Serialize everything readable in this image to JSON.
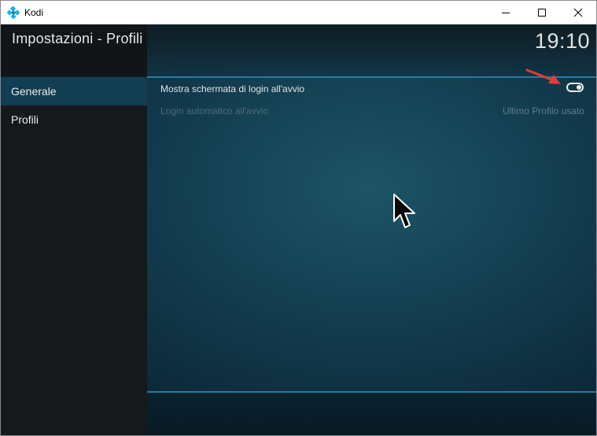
{
  "window": {
    "title": "Kodi",
    "icon": "kodi-logo-icon",
    "controls": [
      "minimize-icon",
      "maximize-icon",
      "close-icon"
    ]
  },
  "header": {
    "title": "Impostazioni - Profili",
    "clock": "19:10"
  },
  "sidebar": {
    "items": [
      {
        "label": "Generale",
        "active": true
      },
      {
        "label": "Profili",
        "active": false
      }
    ]
  },
  "settings": [
    {
      "label": "Mostra schermata di login all'avvio",
      "control": "toggle",
      "state": "on"
    },
    {
      "label": "Login automatico all'avvio",
      "value": "Ultimo Profilo usato",
      "enabled": false
    }
  ],
  "colors": {
    "accent": "#2a7c99",
    "sidebar_bg": "#15191c",
    "active_item": "#123d52",
    "annotation_arrow": "#e53935"
  }
}
